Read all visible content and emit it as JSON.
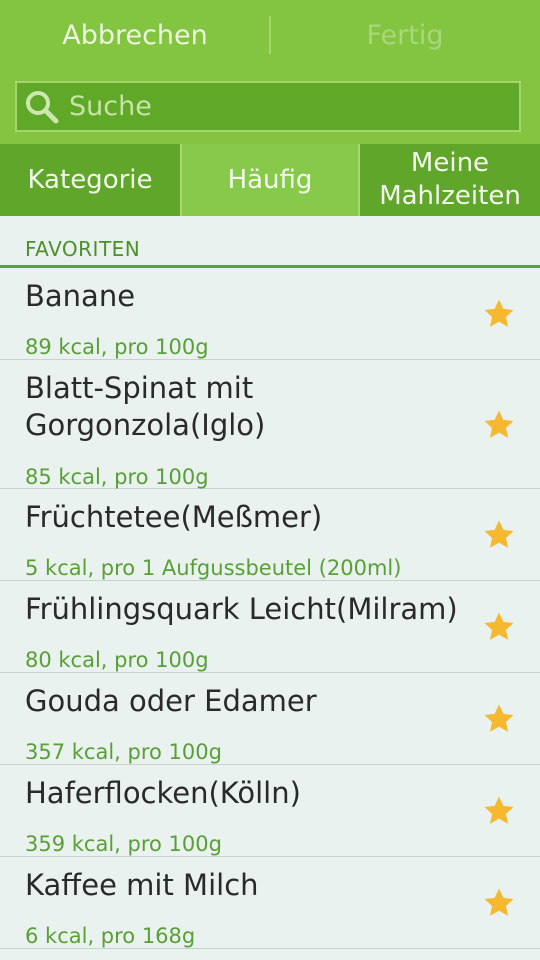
{
  "topbar": {
    "cancel_label": "Abbrechen",
    "done_label": "Fertig"
  },
  "search": {
    "placeholder": "Suche",
    "icon": "search-icon"
  },
  "tabs": [
    {
      "label": "Kategorie",
      "active": false
    },
    {
      "label": "Häufig",
      "active": true
    },
    {
      "label": "Meine Mahlzeiten",
      "active": false
    }
  ],
  "section": {
    "title": "FAVORITEN"
  },
  "colors": {
    "accent": "#83c441",
    "dark_green": "#5fa62a",
    "star": "#f5b82e",
    "subtext": "#58a036"
  },
  "items": [
    {
      "name": "Banane",
      "detail": "89 kcal, pro 100g"
    },
    {
      "name": "Blatt-Spinat mit\nGorgonzola(Iglo)",
      "detail": "85 kcal, pro 100g"
    },
    {
      "name": "Früchtetee(Meßmer)",
      "detail": "5 kcal, pro 1 Aufgussbeutel (200ml)"
    },
    {
      "name": "Frühlingsquark Leicht(Milram)",
      "detail": "80 kcal, pro 100g"
    },
    {
      "name": "Gouda oder Edamer",
      "detail": "357 kcal, pro 100g"
    },
    {
      "name": "Haferflocken(Kölln)",
      "detail": "359 kcal, pro 100g"
    },
    {
      "name": "Kaffee mit Milch",
      "detail": "6 kcal, pro 168g"
    }
  ]
}
